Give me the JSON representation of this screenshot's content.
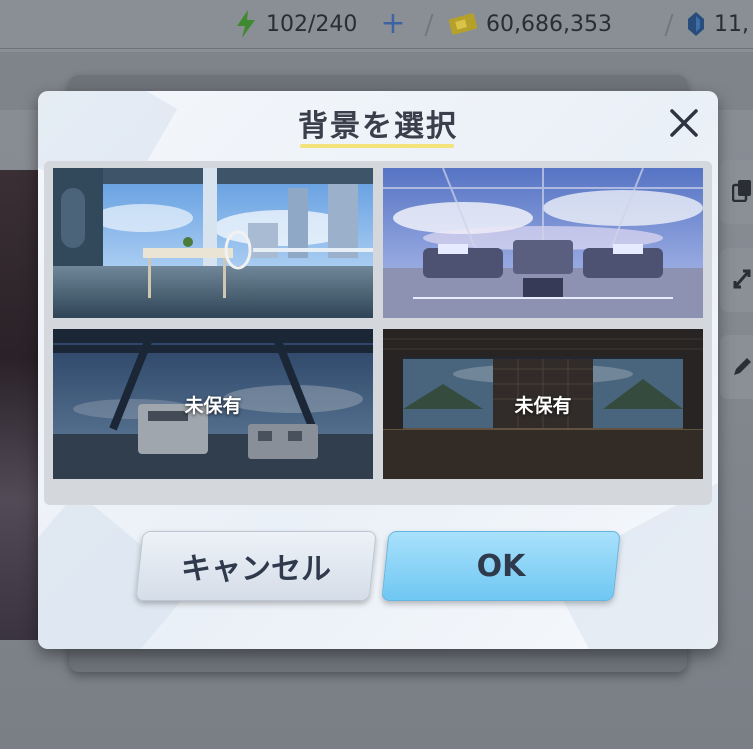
{
  "topbar": {
    "stamina": "102/240",
    "money": "60,686,353",
    "gems": "11,"
  },
  "dialog": {
    "title": "背景を選択",
    "backgrounds": [
      {
        "name": "Sky terrace",
        "locked": false
      },
      {
        "name": "Cloud cockpit",
        "locked": false
      },
      {
        "name": "Bridge",
        "locked": true,
        "label": "未保有"
      },
      {
        "name": "Dojo",
        "locked": true,
        "label": "未保有"
      }
    ],
    "cancel_label": "キャンセル",
    "ok_label": "OK"
  },
  "colors": {
    "title_underline": "#f4e27a",
    "ok_button": "#7fcdf5",
    "cancel_button": "#dfe6ef",
    "overlay": "#7c8289"
  }
}
